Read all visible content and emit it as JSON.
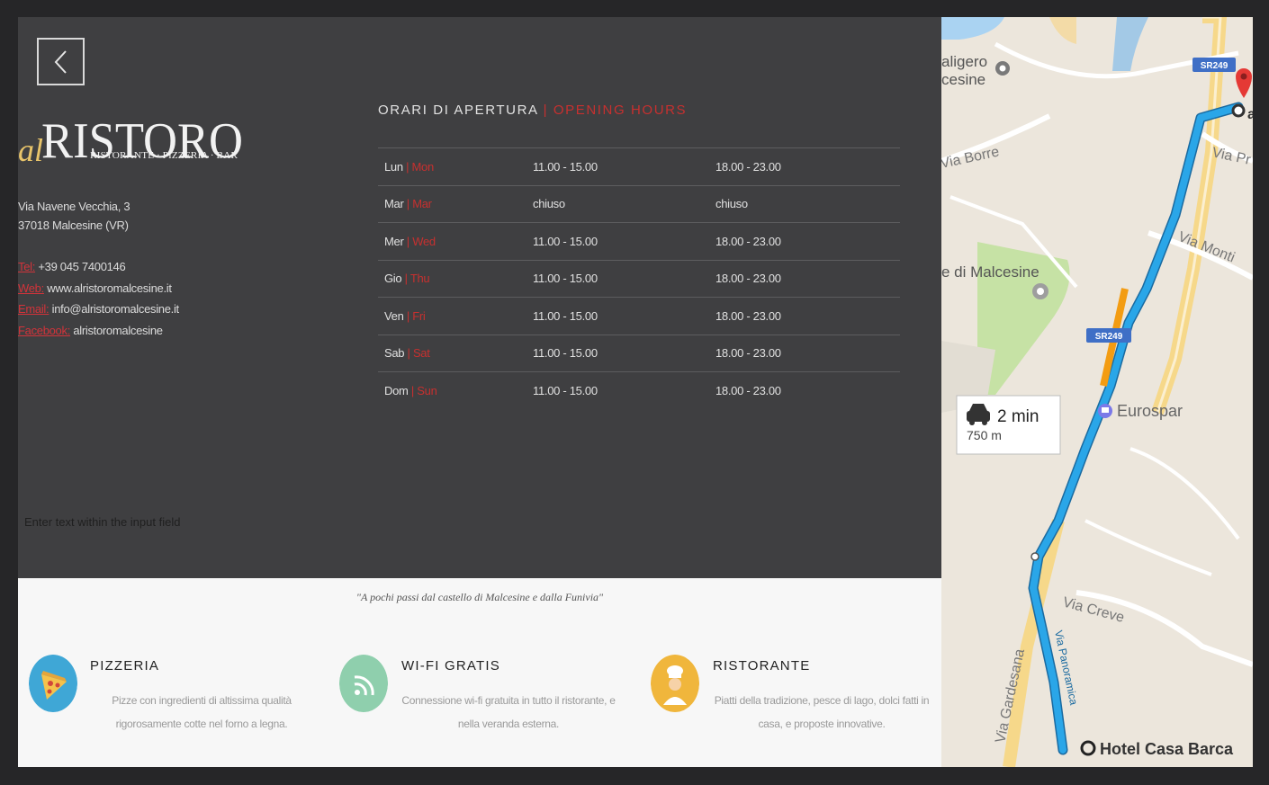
{
  "back_button": {
    "label": "<"
  },
  "logo": {
    "prefix": "al",
    "name": "RISTORO",
    "subtitle": "RISTORANTE · PIZZERIA · BAR"
  },
  "address": {
    "line1": "Via Navene Vecchia, 3",
    "line2": "37018 Malcesine (VR)"
  },
  "contacts": [
    {
      "label": "Tel:",
      "value": " +39 045 7400146"
    },
    {
      "label": "Web:",
      "value": " www.alristoromalcesine.it"
    },
    {
      "label": "Email:",
      "value": " info@alristoromalcesine.it"
    },
    {
      "label": "Facebook:",
      "value": " alristoromalcesine"
    }
  ],
  "hours": {
    "title_it": "ORARI DI APERTURA",
    "separator": " | ",
    "title_en": "OPENING HOURS",
    "rows": [
      {
        "day_it": "Lun",
        "day_en": "Mon",
        "lunch": "11.00 - 15.00",
        "dinner": "18.00 - 23.00"
      },
      {
        "day_it": "Mar",
        "day_en": "Mar",
        "lunch": "chiuso",
        "dinner": "chiuso"
      },
      {
        "day_it": "Mer",
        "day_en": "Wed",
        "lunch": "11.00 - 15.00",
        "dinner": "18.00 - 23.00"
      },
      {
        "day_it": "Gio",
        "day_en": "Thu",
        "lunch": "11.00 - 15.00",
        "dinner": "18.00 - 23.00"
      },
      {
        "day_it": "Ven",
        "day_en": "Fri",
        "lunch": "11.00 - 15.00",
        "dinner": "18.00 - 23.00"
      },
      {
        "day_it": "Sab",
        "day_en": "Sat",
        "lunch": "11.00 - 15.00",
        "dinner": "18.00 - 23.00"
      },
      {
        "day_it": "Dom",
        "day_en": "Sun",
        "lunch": "11.00 - 15.00",
        "dinner": "18.00 - 23.00"
      }
    ]
  },
  "input": {
    "placeholder": "Enter text within the input field"
  },
  "tagline": "\"A pochi passi dal castello di Malcesine e dalla Funivia\"",
  "features": [
    {
      "icon": "pizza-icon",
      "title": "PIZZERIA",
      "desc": "Pizze con ingredienti di altissima qualità rigorosamente cotte nel forno a legna."
    },
    {
      "icon": "wifi-icon",
      "title": "WI-FI GRATIS",
      "desc": "Connessione wi-fi gratuita in tutto il ristorante, e nella veranda esterna."
    },
    {
      "icon": "chef-icon",
      "title": "RISTORANTE",
      "desc": "Piatti della tradizione, pesce di lago, dolci fatti in casa, e proposte innovative."
    }
  ],
  "map": {
    "labels": {
      "place1_a": "aligero",
      "place1_b": "cesine",
      "road1": "Via Borre",
      "road2": "Via Pr",
      "road3": "Via Monti",
      "castle": "e di Malcesine",
      "shop": "Eurospar",
      "road4": "Via Creve",
      "road5": "Via Gardesana",
      "road6": "Via Panoramica",
      "hotel": "Hotel Casa Barca",
      "shield1": "SR249",
      "shield2": "SR249",
      "dest_marker": "a"
    },
    "route": {
      "duration": "2 min",
      "distance": "750 m"
    },
    "colors": {
      "route": "#2aa6e8",
      "traffic": "#f39c12",
      "pin": "#e53935"
    }
  }
}
